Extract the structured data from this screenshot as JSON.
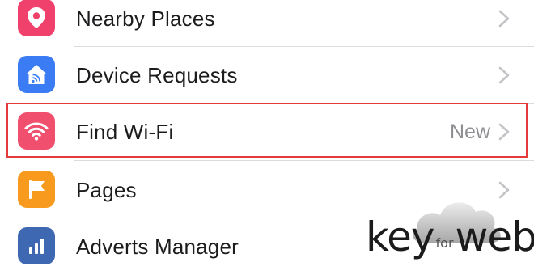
{
  "menu": {
    "items": [
      {
        "label": "Nearby Places",
        "icon": "location-pin-icon",
        "color": "#f0416c",
        "detail": ""
      },
      {
        "label": "Device Requests",
        "icon": "home-cast-icon",
        "color": "#3b7cf5",
        "detail": ""
      },
      {
        "label": "Find Wi-Fi",
        "icon": "wifi-icon",
        "color": "#f0506e",
        "detail": "New"
      },
      {
        "label": "Pages",
        "icon": "flag-icon",
        "color": "#f79a1e",
        "detail": ""
      },
      {
        "label": "Adverts Manager",
        "icon": "bar-chart-icon",
        "color": "#3f68b2",
        "detail": ""
      }
    ]
  },
  "highlight": {
    "color": "#e33a3a"
  },
  "watermark": {
    "key": "key",
    "for": "for",
    "web": "web"
  }
}
